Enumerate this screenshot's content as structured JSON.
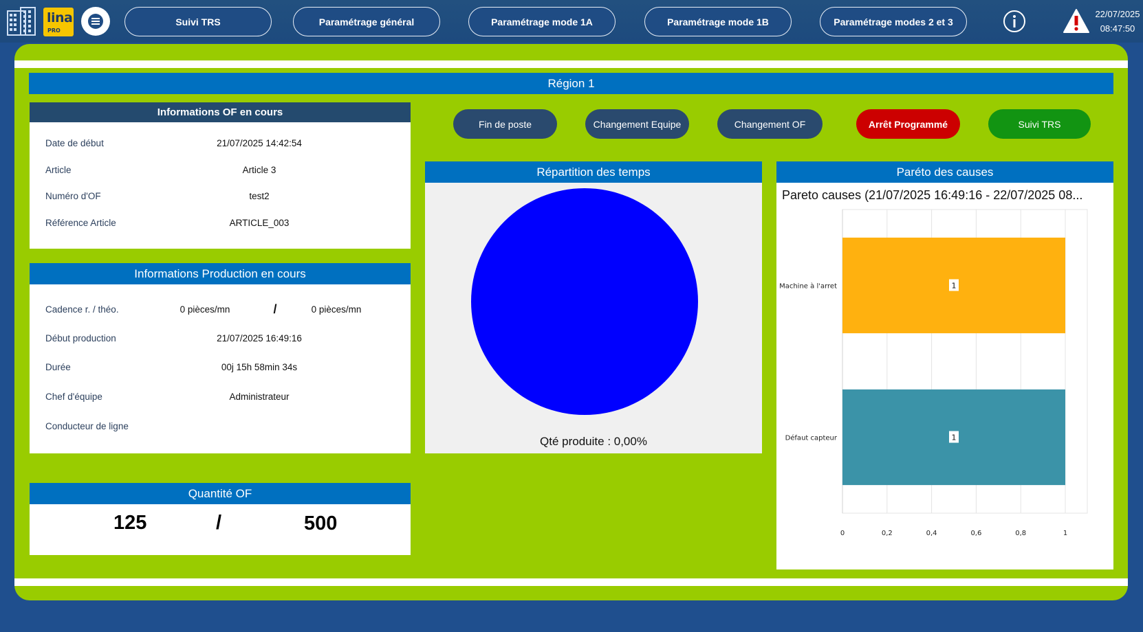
{
  "topbar": {
    "logo_main": "lina",
    "logo_sub": "PRO",
    "nav": [
      "Suivi TRS",
      "Paramétrage général",
      "Paramétrage mode 1A",
      "Paramétrage mode 1B",
      "Paramétrage modes 2 et 3"
    ],
    "date": "22/07/2025",
    "time": "08:47:50"
  },
  "region": {
    "title": "Région 1"
  },
  "of_info": {
    "title": "Informations OF en cours",
    "rows": [
      {
        "label": "Date de début",
        "value": "21/07/2025 14:42:54"
      },
      {
        "label": "Article",
        "value": "Article 3"
      },
      {
        "label": "Numéro d'OF",
        "value": "test2"
      },
      {
        "label": "Référence Article",
        "value": "ARTICLE_003"
      }
    ]
  },
  "prod_info": {
    "title": "Informations Production en cours",
    "cadence_label": "Cadence r. / théo.",
    "cadence_real": "0 pièces/mn",
    "cadence_sep": "/",
    "cadence_theo": "0 pièces/mn",
    "rows": [
      {
        "label": "Début production",
        "value": "21/07/2025 16:49:16"
      },
      {
        "label": "Durée",
        "value": "00j 15h 58min 34s"
      },
      {
        "label": "Chef d'équipe",
        "value": "Administrateur"
      },
      {
        "label": "Conducteur de ligne",
        "value": ""
      }
    ]
  },
  "quantity": {
    "title": "Quantité OF",
    "produced": "125",
    "sep": "/",
    "target": "500"
  },
  "actions": {
    "fin_poste": "Fin de poste",
    "changement_equipe": "Changement Equipe",
    "changement_of": "Changement OF",
    "arret_programme": "Arrêt Programmé",
    "suivi_trs": "Suivi TRS"
  },
  "colors": {
    "accent_blue": "#0070c0",
    "frame_green": "#99cc00",
    "dark_button": "#2a4a6e",
    "stop_red": "#cc0000",
    "trs_green": "#129412",
    "pie_blue": "#0000ff",
    "bar_orange": "#ffb10f",
    "bar_teal": "#3b93a8"
  },
  "chart_data": [
    {
      "type": "pie",
      "title": "Répartition des temps",
      "slices": [
        {
          "value": 100,
          "color": "#0000ff"
        }
      ],
      "footer": "Qté produite : 0,00%"
    },
    {
      "type": "bar",
      "orientation": "horizontal",
      "panel_title": "Paréto des causes",
      "title": "Pareto causes (21/07/2025 16:49:16 - 22/07/2025 08...",
      "categories": [
        "Machine à l'arret",
        "Défaut capteur"
      ],
      "values": [
        1,
        1
      ],
      "colors": [
        "#ffb10f",
        "#3b93a8"
      ],
      "xlim": [
        0,
        1
      ],
      "xticks": [
        "0",
        "0,2",
        "0,4",
        "0,6",
        "0,8",
        "1"
      ],
      "grid": true,
      "data_labels": [
        "1",
        "1"
      ]
    }
  ]
}
